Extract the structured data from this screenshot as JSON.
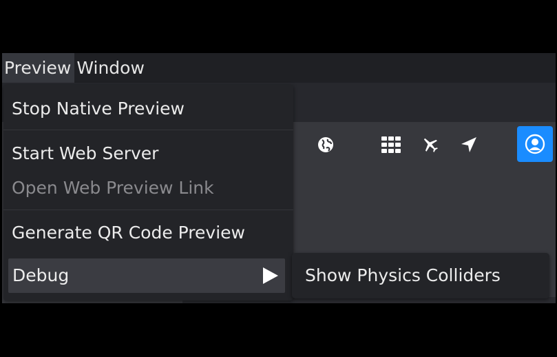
{
  "menubar": {
    "items": [
      {
        "label": "Preview",
        "active": true
      },
      {
        "label": "Window",
        "active": false
      }
    ]
  },
  "preview_menu": {
    "stop_native_preview": "Stop Native Preview",
    "start_web_server": "Start Web Server",
    "open_web_preview_link": "Open Web Preview Link",
    "generate_qr_code_preview": "Generate QR Code Preview",
    "debug": "Debug"
  },
  "debug_submenu": {
    "show_physics_colliders": "Show Physics Colliders"
  },
  "toolbar": {
    "icons": [
      "globe-icon",
      "grid-icon",
      "airplane-icon",
      "location-arrow-icon",
      "user-profile-icon"
    ]
  },
  "colors": {
    "accent": "#1a8cff",
    "menu_bg": "#232428",
    "highlight": "#3b3c42",
    "disabled_text": "#8a8a8e"
  }
}
